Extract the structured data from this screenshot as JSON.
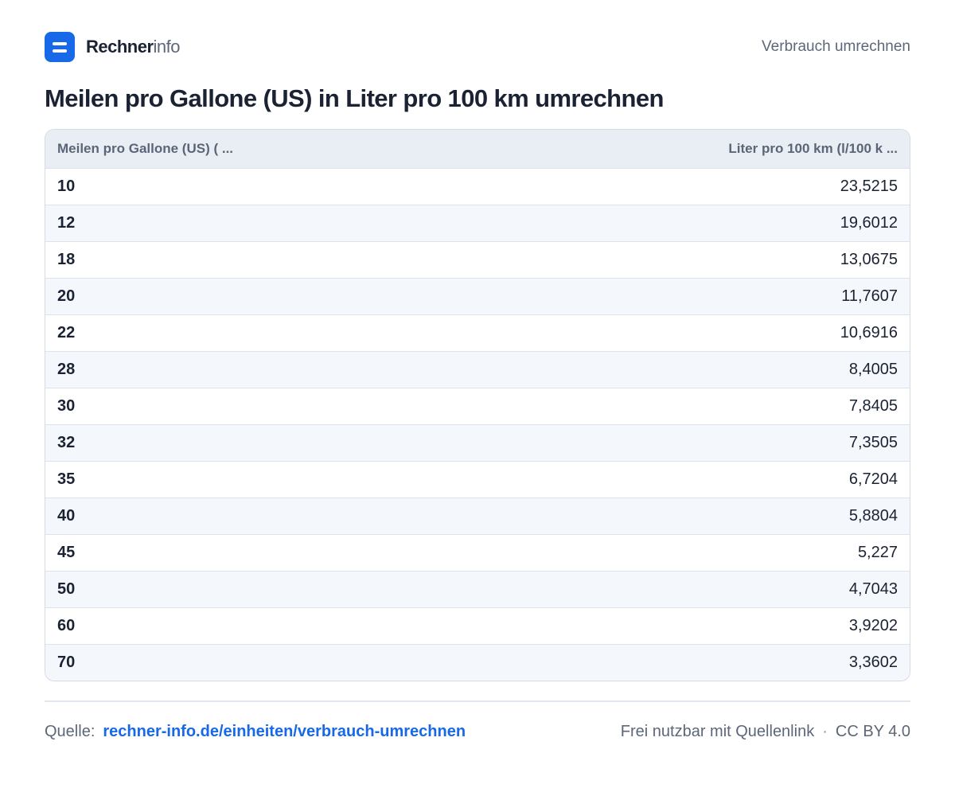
{
  "header": {
    "brand_strong": "Rechner",
    "brand_light": "info",
    "nav_link": "Verbrauch umrechnen"
  },
  "page": {
    "title": "Meilen pro Gallone (US) in Liter pro 100 km umrechnen"
  },
  "table": {
    "columns": [
      "Meilen pro Gallone (US) ( ...",
      "Liter pro 100 km (l/100 k ..."
    ],
    "rows": [
      [
        "10",
        "23,5215"
      ],
      [
        "12",
        "19,6012"
      ],
      [
        "18",
        "13,0675"
      ],
      [
        "20",
        "11,7607"
      ],
      [
        "22",
        "10,6916"
      ],
      [
        "28",
        "8,4005"
      ],
      [
        "30",
        "7,8405"
      ],
      [
        "32",
        "7,3505"
      ],
      [
        "35",
        "6,7204"
      ],
      [
        "40",
        "5,8804"
      ],
      [
        "45",
        "5,227"
      ],
      [
        "50",
        "4,7043"
      ],
      [
        "60",
        "3,9202"
      ],
      [
        "70",
        "3,3602"
      ]
    ]
  },
  "footer": {
    "source_label": "Quelle:",
    "source_link": "rechner-info.de/einheiten/verbrauch-umrechnen",
    "license_text": "Frei nutzbar mit Quellenlink",
    "separator": "·",
    "license_name": "CC BY 4.0"
  },
  "colors": {
    "accent": "#1769e8",
    "text": "#1a2233",
    "muted": "#5d6777",
    "header_bg": "#e9eef5",
    "row_alt_bg": "#f4f7fb"
  }
}
